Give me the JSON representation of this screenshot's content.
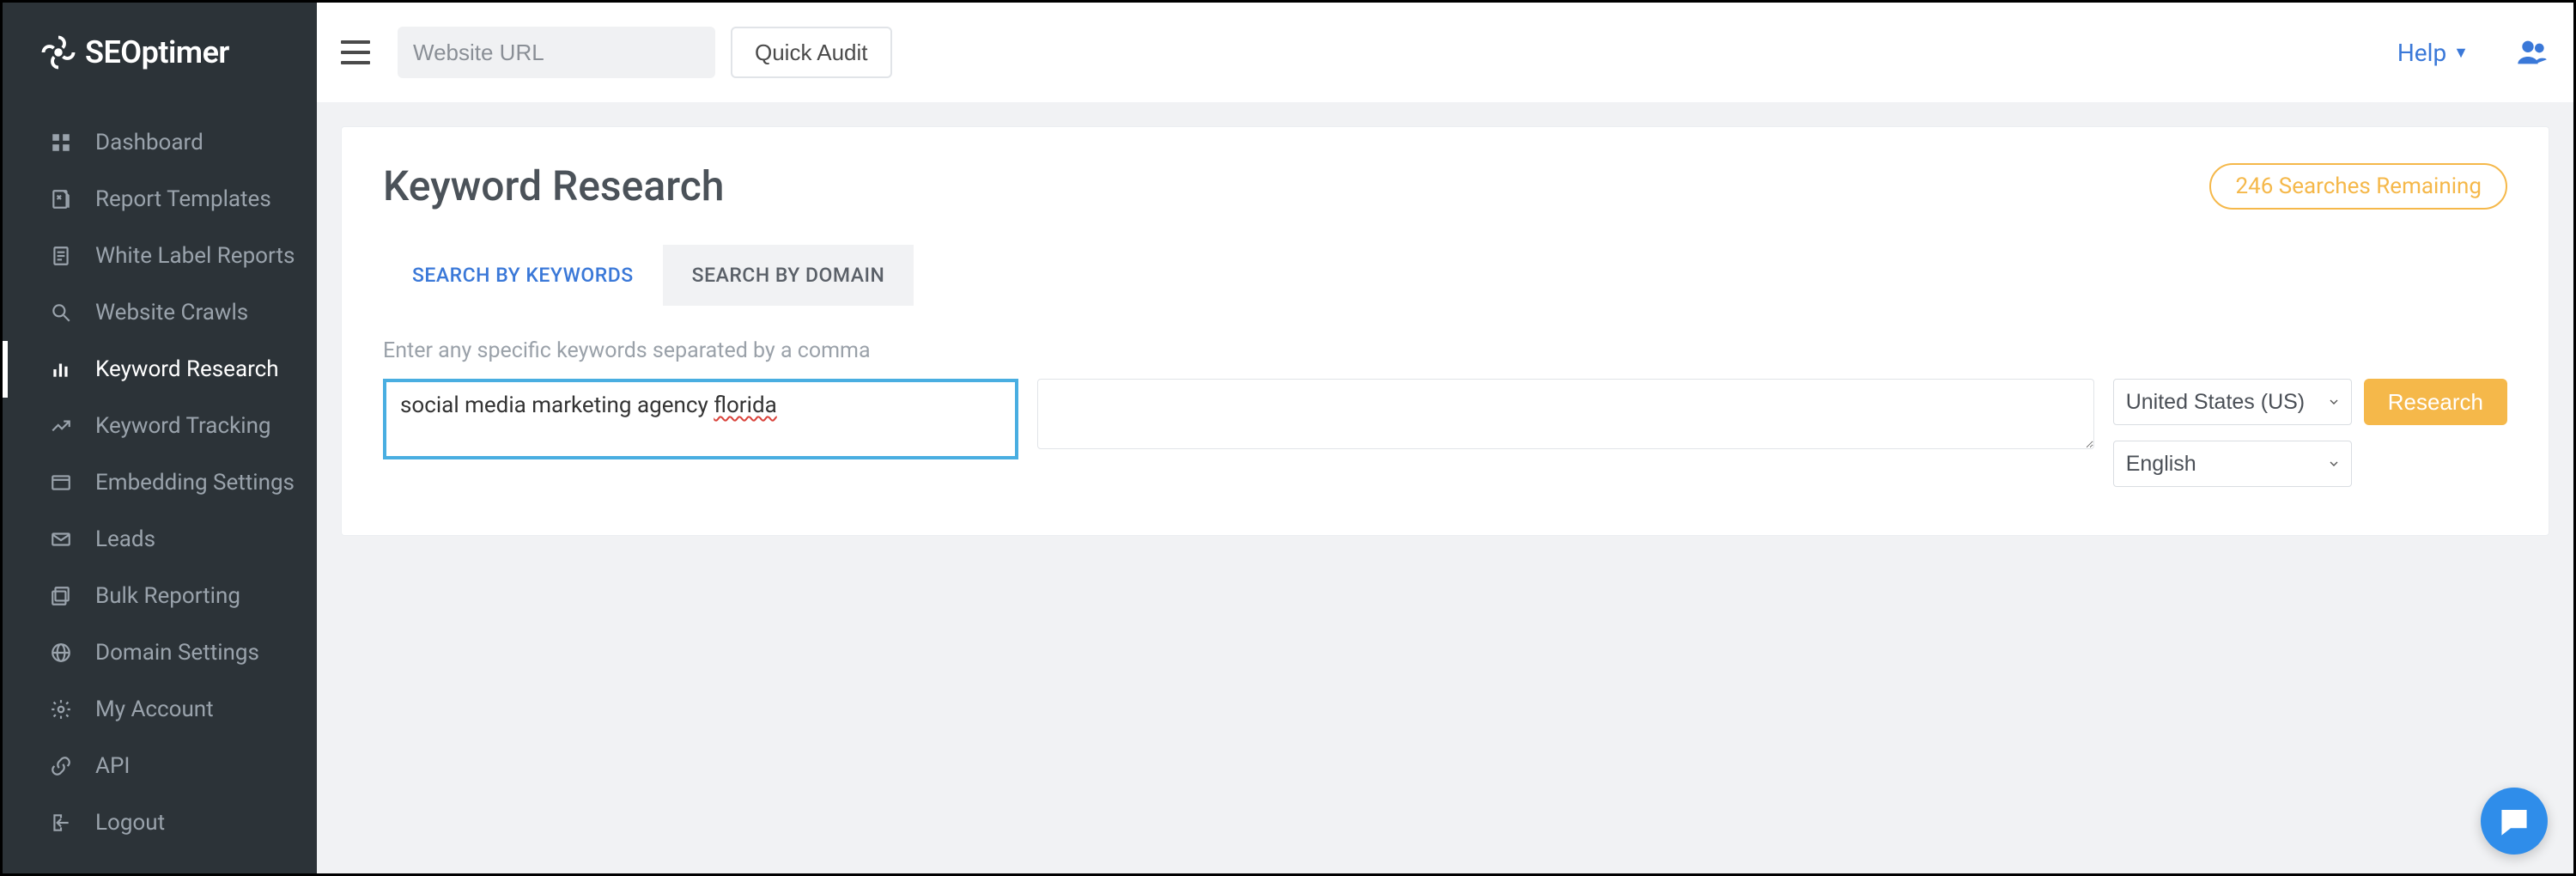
{
  "brand": {
    "name": "SEOptimer"
  },
  "topbar": {
    "url_placeholder": "Website URL",
    "quick_audit_label": "Quick Audit",
    "help_label": "Help"
  },
  "sidebar": {
    "items": [
      {
        "label": "Dashboard",
        "icon": "dashboard-icon"
      },
      {
        "label": "Report Templates",
        "icon": "template-icon"
      },
      {
        "label": "White Label Reports",
        "icon": "document-icon"
      },
      {
        "label": "Website Crawls",
        "icon": "search-icon"
      },
      {
        "label": "Keyword Research",
        "icon": "barchart-icon"
      },
      {
        "label": "Keyword Tracking",
        "icon": "trend-icon"
      },
      {
        "label": "Embedding Settings",
        "icon": "code-icon"
      },
      {
        "label": "Leads",
        "icon": "envelope-icon"
      },
      {
        "label": "Bulk Reporting",
        "icon": "stack-icon"
      },
      {
        "label": "Domain Settings",
        "icon": "globe-icon"
      },
      {
        "label": "My Account",
        "icon": "gear-icon"
      },
      {
        "label": "API",
        "icon": "link-icon"
      },
      {
        "label": "Logout",
        "icon": "logout-icon"
      }
    ],
    "active_index": 4
  },
  "page": {
    "title": "Keyword Research",
    "searches_remaining": "246 Searches Remaining",
    "tabs": [
      {
        "label": "SEARCH BY KEYWORDS",
        "active": true
      },
      {
        "label": "SEARCH BY DOMAIN",
        "active": false
      }
    ],
    "hint": "Enter any specific keywords separated by a comma",
    "keyword_input_prefix": "social media marketing agency ",
    "keyword_input_underlined": "florida",
    "country_select": "United States (US)",
    "language_select": "English",
    "research_button": "Research"
  }
}
